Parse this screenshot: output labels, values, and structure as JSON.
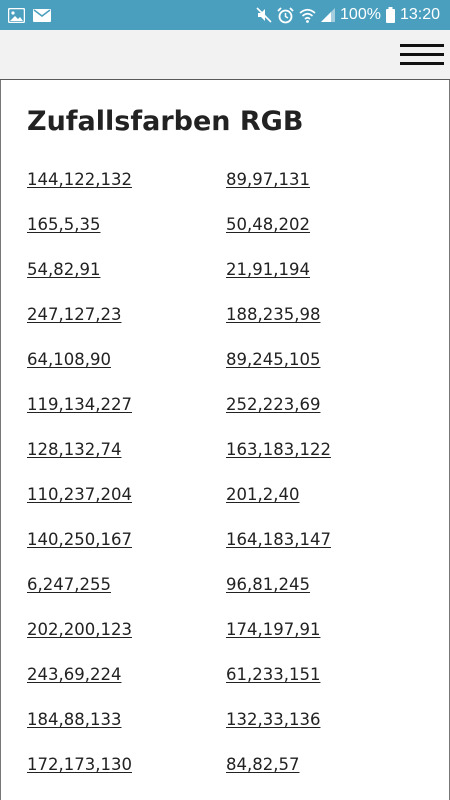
{
  "status_bar": {
    "battery": "100%",
    "time": "13:20",
    "left_icons": [
      "image-icon",
      "mail-icon"
    ],
    "right_icons": [
      "mute-icon",
      "alarm-icon",
      "wifi-icon",
      "signal-icon",
      "battery-icon"
    ]
  },
  "app_bar": {
    "menu_icon": "hamburger-menu-icon"
  },
  "page": {
    "title": "Zufallsfarben RGB",
    "rows": [
      {
        "left": "144,122,132",
        "right": "89,97,131"
      },
      {
        "left": "165,5,35",
        "right": "50,48,202"
      },
      {
        "left": "54,82,91",
        "right": "21,91,194"
      },
      {
        "left": "247,127,23",
        "right": "188,235,98"
      },
      {
        "left": "64,108,90",
        "right": "89,245,105"
      },
      {
        "left": "119,134,227",
        "right": "252,223,69"
      },
      {
        "left": "128,132,74",
        "right": "163,183,122"
      },
      {
        "left": "110,237,204",
        "right": "201,2,40"
      },
      {
        "left": "140,250,167",
        "right": "164,183,147"
      },
      {
        "left": "6,247,255",
        "right": "96,81,245"
      },
      {
        "left": "202,200,123",
        "right": "174,197,91"
      },
      {
        "left": "243,69,224",
        "right": "61,233,151"
      },
      {
        "left": "184,88,133",
        "right": "132,33,136"
      },
      {
        "left": "172,173,130",
        "right": "84,82,57"
      }
    ]
  },
  "colors": {
    "status_bar": "#4a9fbf",
    "app_bar": "#f2f2f2",
    "text": "#222222"
  }
}
